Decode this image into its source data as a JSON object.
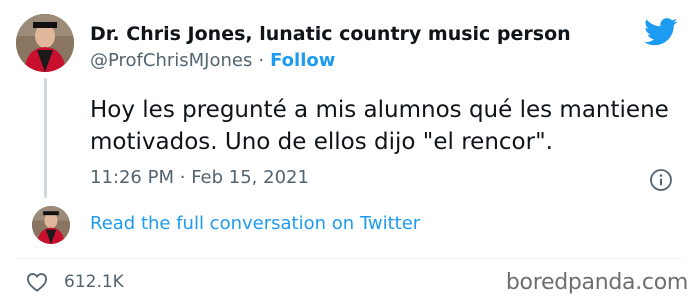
{
  "author": {
    "name": "Dr. Chris Jones, lunatic country music person",
    "handle": "@ProfChrisMJones",
    "separator": "·",
    "follow_label": "Follow"
  },
  "tweet": {
    "text": "Hoy les pregunté a mis alumnos qué les mantiene motivados. Uno de ellos dijo \"el rencor\".",
    "time": "11:26 PM",
    "date_separator": "·",
    "date": "Feb 15, 2021"
  },
  "conversation_link": "Read the full conversation on Twitter",
  "likes": "612.1K",
  "watermark": "boredpanda.com",
  "colors": {
    "twitter_blue": "#1d9bf0",
    "text": "#0f1419",
    "muted": "#536471"
  },
  "icons": {
    "brand": "twitter-bird-icon",
    "info": "info-icon",
    "like": "heart-icon"
  }
}
